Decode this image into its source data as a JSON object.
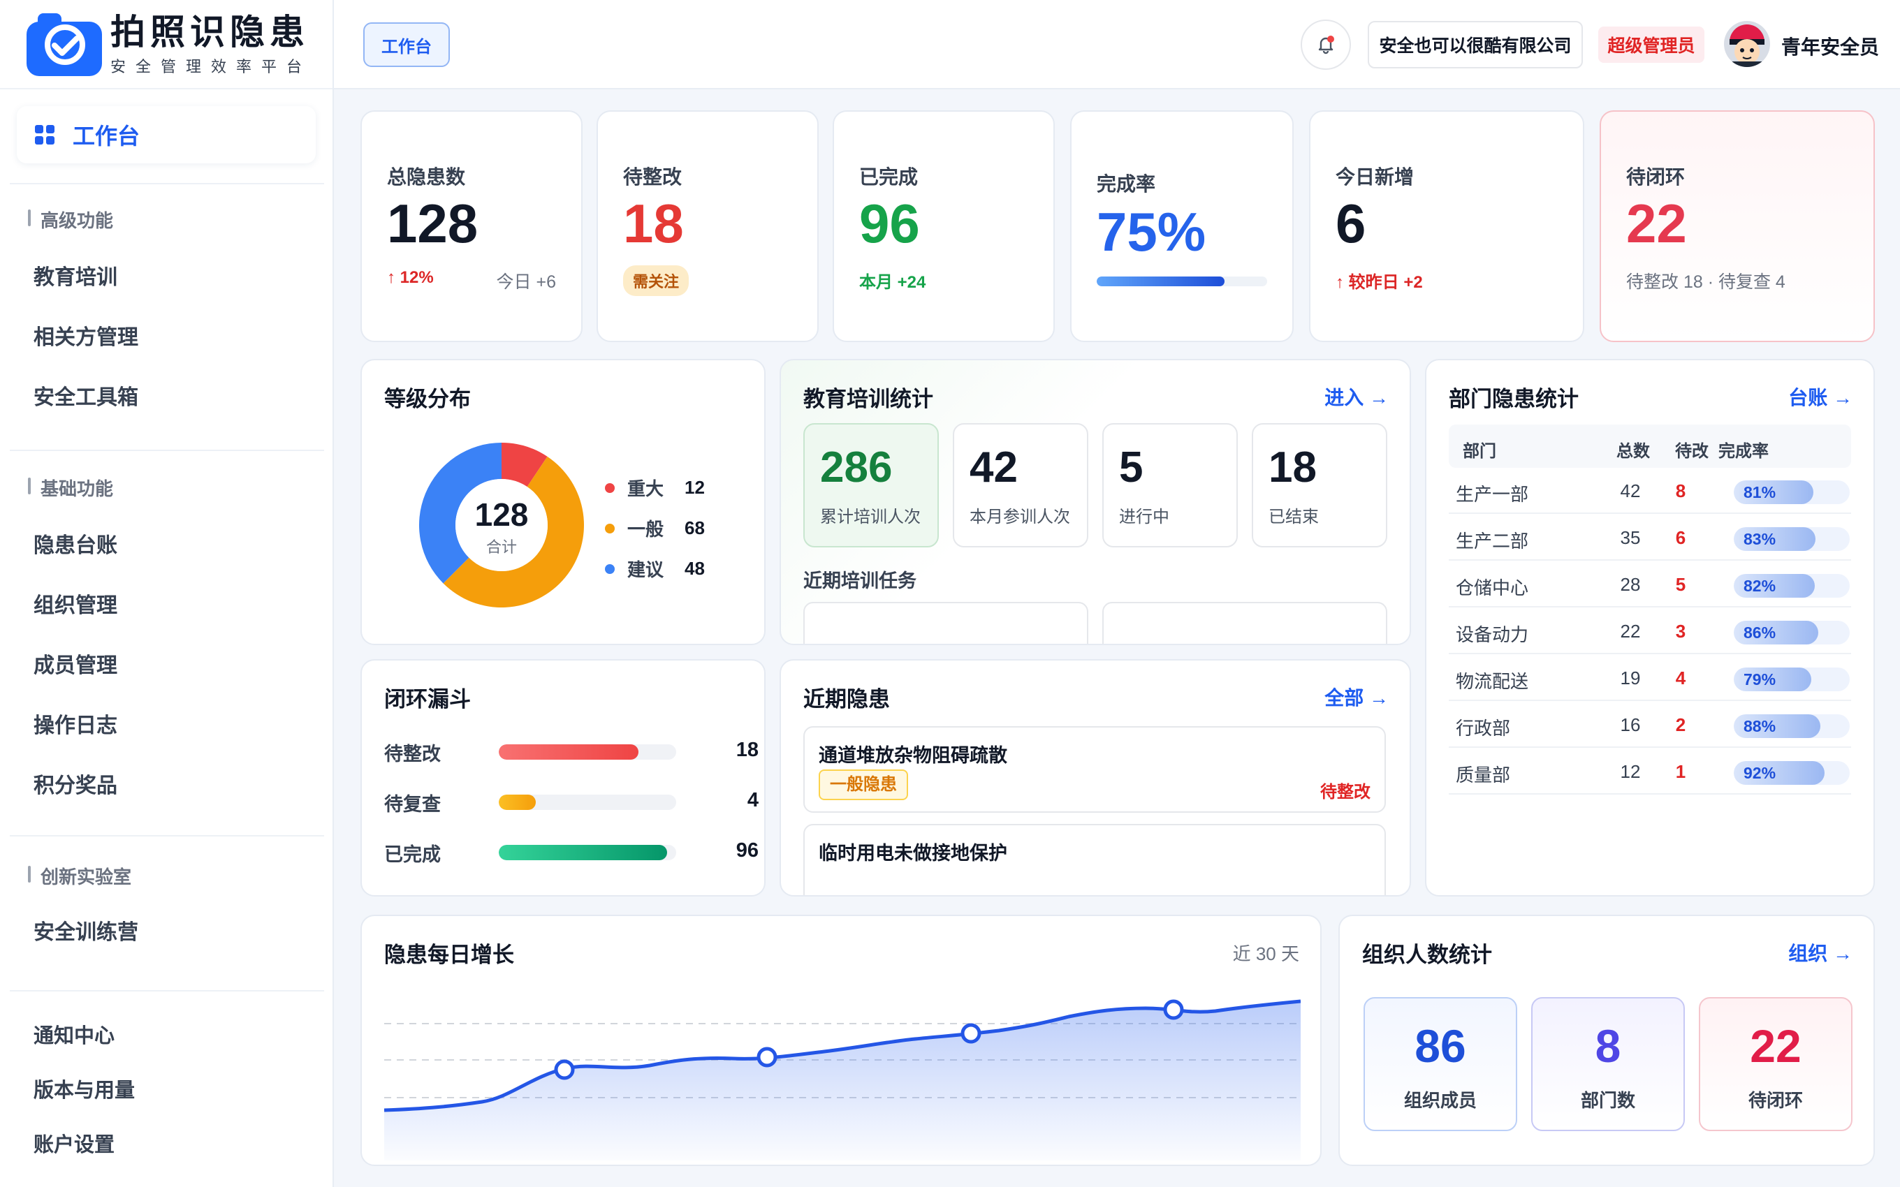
{
  "brand": {
    "title": "拍照识隐患",
    "subtitle": "安全管理效率平台"
  },
  "sidebar": {
    "active": "工作台",
    "groups": [
      {
        "label": "高级功能",
        "items": [
          "教育培训",
          "相关方管理",
          "安全工具箱"
        ]
      },
      {
        "label": "基础功能",
        "items": [
          "隐患台账",
          "组织管理",
          "成员管理",
          "操作日志",
          "积分奖品"
        ]
      },
      {
        "label": "创新实验室",
        "items": [
          "安全训练营"
        ]
      }
    ],
    "bottom": [
      "通知中心",
      "版本与用量",
      "账户设置"
    ]
  },
  "header": {
    "tab": "工作台",
    "company": "安全也可以很酷有限公司",
    "role": "超级管理员",
    "user": "青年安全员"
  },
  "kpis": [
    {
      "label": "总隐患数",
      "value": "128",
      "trend": "↑ 12%",
      "extra": "今日 +6"
    },
    {
      "label": "待整改",
      "value": "18",
      "badge": "需关注"
    },
    {
      "label": "已完成",
      "value": "96",
      "sub": "本月 +24"
    },
    {
      "label": "完成率",
      "value": "75%",
      "progress": 0.75
    },
    {
      "label": "今日新增",
      "value": "6",
      "sub": "↑ 较昨日 +2"
    },
    {
      "label": "待闭环",
      "value": "22",
      "sub": "待整改 18 · 待复查 4"
    }
  ],
  "level": {
    "title": "等级分布",
    "total": "128",
    "total_label": "合计",
    "items": [
      {
        "name": "重大",
        "value": "12",
        "color": "#ef4444"
      },
      {
        "name": "一般",
        "value": "68",
        "color": "#f59e0b"
      },
      {
        "name": "建议",
        "value": "48",
        "color": "#3b82f6"
      }
    ]
  },
  "training": {
    "title": "教育培训统计",
    "link": "进入 →",
    "stats": [
      {
        "value": "286",
        "label": "累计培训人次"
      },
      {
        "value": "42",
        "label": "本月参训人次"
      },
      {
        "value": "5",
        "label": "进行中"
      },
      {
        "value": "18",
        "label": "已结束"
      }
    ],
    "recent": "近期培训任务"
  },
  "dept": {
    "title": "部门隐患统计",
    "link": "台账 →",
    "headers": [
      "部门",
      "总数",
      "待改",
      "完成率"
    ],
    "rows": [
      {
        "name": "生产一部",
        "total": "42",
        "pending": "8",
        "rate": "81%",
        "pct": 0.81
      },
      {
        "name": "生产二部",
        "total": "35",
        "pending": "6",
        "rate": "83%",
        "pct": 0.83
      },
      {
        "name": "仓储中心",
        "total": "28",
        "pending": "5",
        "rate": "82%",
        "pct": 0.82
      },
      {
        "name": "设备动力",
        "total": "22",
        "pending": "3",
        "rate": "86%",
        "pct": 0.86
      },
      {
        "name": "物流配送",
        "total": "19",
        "pending": "4",
        "rate": "79%",
        "pct": 0.79
      },
      {
        "name": "行政部",
        "total": "16",
        "pending": "2",
        "rate": "88%",
        "pct": 0.88
      },
      {
        "name": "质量部",
        "total": "12",
        "pending": "1",
        "rate": "92%",
        "pct": 0.92
      }
    ]
  },
  "funnel": {
    "title": "闭环漏斗",
    "rows": [
      {
        "label": "待整改",
        "value": "18",
        "pct": 0.83
      },
      {
        "label": "待复查",
        "value": "4",
        "pct": 0.22
      },
      {
        "label": "已完成",
        "value": "96",
        "pct": 1.0
      }
    ]
  },
  "hazards": {
    "title": "近期隐患",
    "link": "全部 →",
    "items": [
      {
        "title": "通道堆放杂物阻碍疏散",
        "level": "一般隐患",
        "status": "待整改"
      },
      {
        "title": "临时用电未做接地保护"
      }
    ]
  },
  "growth": {
    "title": "隐患每日增长",
    "range": "近 30 天"
  },
  "org": {
    "title": "组织人数统计",
    "link": "组织 →",
    "stats": [
      {
        "value": "86",
        "label": "组织成员"
      },
      {
        "value": "8",
        "label": "部门数"
      },
      {
        "value": "22",
        "label": "待闭环"
      }
    ]
  }
}
